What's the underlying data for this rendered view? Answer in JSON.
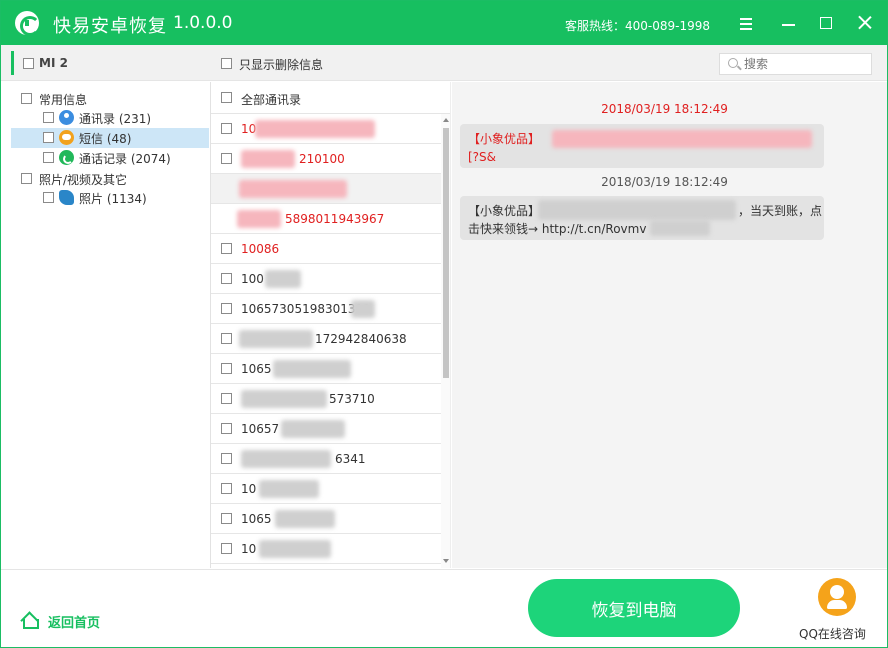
{
  "app": {
    "title": "快易安卓恢复",
    "version": "1.0.0.0",
    "hotline": "客服热线：400-089-1998"
  },
  "header": {
    "device": "MI 2",
    "only_deleted": "只显示删除信息",
    "search_placeholder": "搜索"
  },
  "tree": {
    "groups": [
      {
        "label": "常用信息",
        "items": [
          {
            "label": "通讯录 (231)"
          },
          {
            "label": "短信 (48)"
          },
          {
            "label": "通话记录 (2074)"
          }
        ]
      },
      {
        "label": "照片/视频及其它",
        "items": [
          {
            "label": "照片 (1134)"
          }
        ]
      }
    ]
  },
  "contacts": {
    "header": "全部通讯录",
    "rows": [
      {
        "number": "10",
        "deleted": true
      },
      {
        "number": "210100",
        "deleted": true
      },
      {
        "number": "",
        "deleted": true
      },
      {
        "number": "5898011943967",
        "deleted": true
      },
      {
        "number": "10086",
        "deleted": true
      },
      {
        "number": "100",
        "deleted": false
      },
      {
        "number": "10657305198301311",
        "deleted": false
      },
      {
        "number": "172942840638",
        "deleted": false
      },
      {
        "number": "1065",
        "deleted": false
      },
      {
        "number": "573710",
        "deleted": false
      },
      {
        "number": "10657",
        "deleted": false
      },
      {
        "number": "6341",
        "deleted": false
      },
      {
        "number": "10",
        "deleted": false
      },
      {
        "number": "1065",
        "deleted": false
      },
      {
        "number": "10",
        "deleted": false
      }
    ]
  },
  "messages": [
    {
      "time": "2018/03/19 18:12:49",
      "line1": "【小象优品】",
      "line2": "[?S&"
    },
    {
      "time": "2018/03/19 18:12:49",
      "line1": "【小象优品】",
      "line1_tail": "，当天到账，点",
      "line2": "击快来领钱→ http://t.cn/Rovmv"
    }
  ],
  "footer": {
    "home": "返回首页",
    "recover": "恢复到电脑",
    "qq": "QQ在线咨询"
  },
  "colors": {
    "brand": "#17bf60",
    "button": "#1dd47a",
    "deleted": "#e02020",
    "qq": "#f5a31a"
  }
}
